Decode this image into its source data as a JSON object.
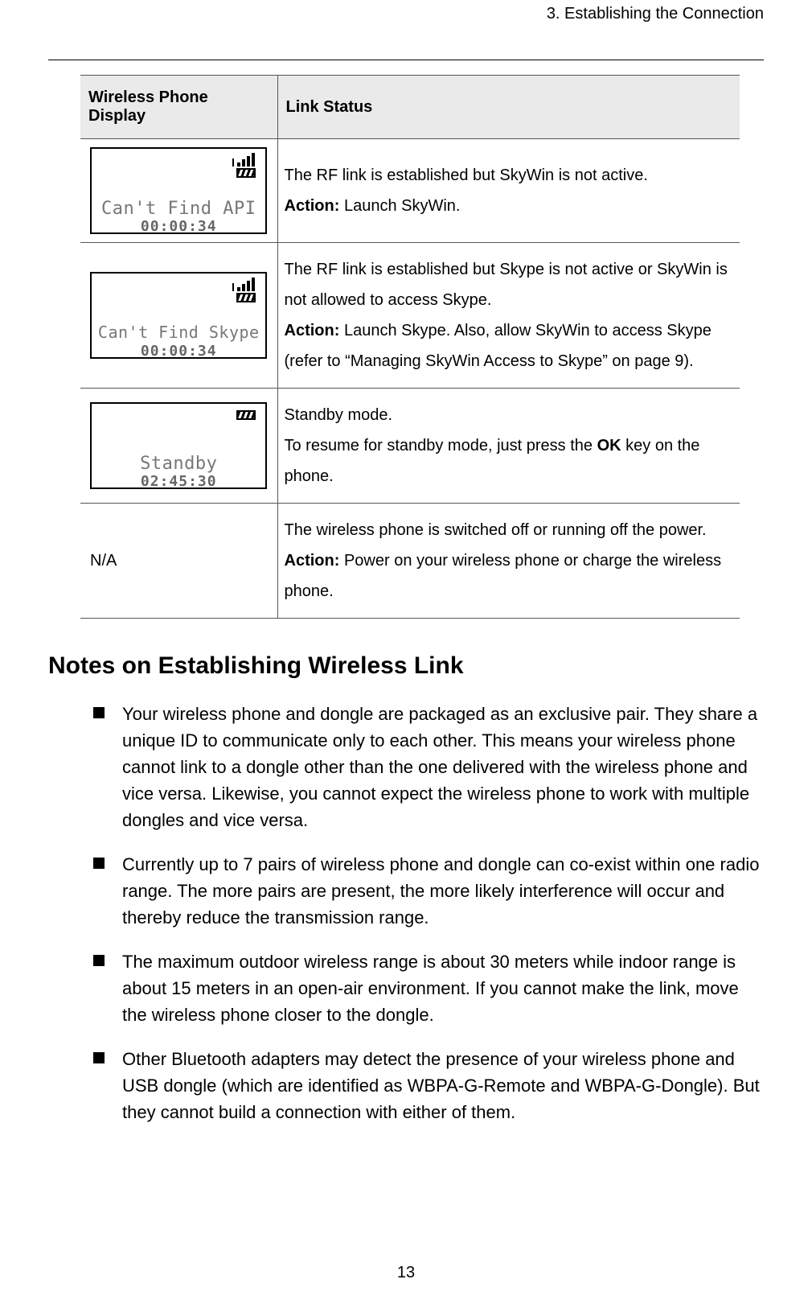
{
  "header": {
    "chapter": "3. Establishing the Connection"
  },
  "table": {
    "columns": {
      "col1": "Wireless Phone Display",
      "col2": "Link Status"
    },
    "rows": [
      {
        "display": {
          "line1": "Can't Find API",
          "line2": "00:00:34",
          "signal": true
        },
        "status_text": "The RF link is established but SkyWin is not active.",
        "action_label": "Action:",
        "action_text": " Launch SkyWin."
      },
      {
        "display": {
          "line1": "Can't Find Skype",
          "line2": "00:00:34",
          "signal": true
        },
        "status_text": "The RF link is established but Skype is not active or SkyWin is not allowed to access Skype.",
        "action_label": "Action:",
        "action_text": " Launch Skype. Also, allow SkyWin to access Skype (refer to “Managing SkyWin Access to Skype” on page 9)."
      },
      {
        "display": {
          "line1": "Standby",
          "line2": "02:45:30",
          "signal": false
        },
        "status_text_pre": "Standby mode.",
        "status_text": "To resume for standby mode, just press the ",
        "ok_key": "OK",
        "status_text_post": " key on the phone."
      },
      {
        "na": "N/A",
        "status_text": "The wireless phone is switched off or running off the power.",
        "action_label": "Action:",
        "action_text": " Power on your wireless phone or charge the wireless phone."
      }
    ]
  },
  "notes": {
    "heading": "Notes on Establishing Wireless Link",
    "items": [
      "Your wireless phone and dongle are packaged as an exclusive pair. They share a unique ID to communicate only to each other. This means your wireless phone cannot link to a dongle other than the one delivered with the wireless phone and vice versa. Likewise, you cannot expect the wireless phone to work with multiple dongles and vice versa.",
      "Currently up to 7 pairs of wireless phone and dongle can co-exist within one radio range. The more pairs are present, the more likely interference will occur and thereby reduce the transmission range.",
      "The maximum outdoor wireless range is about 30 meters while indoor range is about 15 meters in an open-air environment. If you cannot make the link, move the wireless phone closer to the dongle.",
      "Other Bluetooth adapters may detect the presence of your wireless phone and USB dongle (which are identified as WBPA-G-Remote and WBPA-G-Dongle). But they cannot build a connection with either of them."
    ]
  },
  "page_number": "13"
}
